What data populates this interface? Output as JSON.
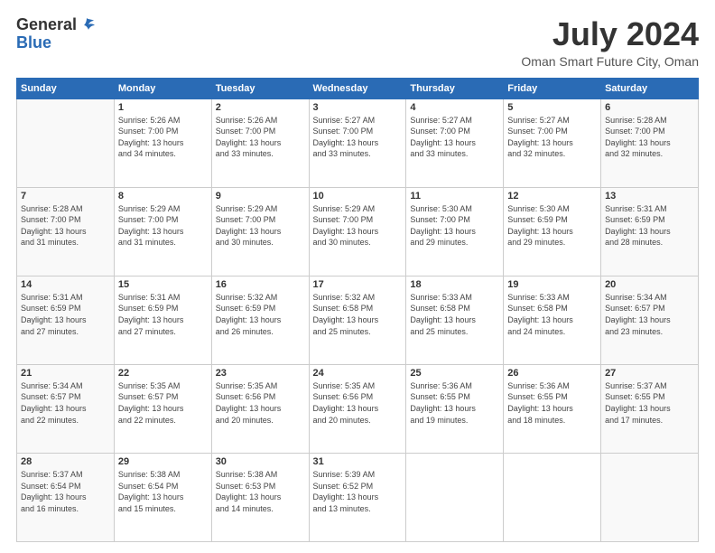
{
  "header": {
    "logo_general": "General",
    "logo_blue": "Blue",
    "month": "July 2024",
    "location": "Oman Smart Future City, Oman"
  },
  "weekdays": [
    "Sunday",
    "Monday",
    "Tuesday",
    "Wednesday",
    "Thursday",
    "Friday",
    "Saturday"
  ],
  "weeks": [
    [
      {
        "day": "",
        "info": ""
      },
      {
        "day": "1",
        "info": "Sunrise: 5:26 AM\nSunset: 7:00 PM\nDaylight: 13 hours\nand 34 minutes."
      },
      {
        "day": "2",
        "info": "Sunrise: 5:26 AM\nSunset: 7:00 PM\nDaylight: 13 hours\nand 33 minutes."
      },
      {
        "day": "3",
        "info": "Sunrise: 5:27 AM\nSunset: 7:00 PM\nDaylight: 13 hours\nand 33 minutes."
      },
      {
        "day": "4",
        "info": "Sunrise: 5:27 AM\nSunset: 7:00 PM\nDaylight: 13 hours\nand 33 minutes."
      },
      {
        "day": "5",
        "info": "Sunrise: 5:27 AM\nSunset: 7:00 PM\nDaylight: 13 hours\nand 32 minutes."
      },
      {
        "day": "6",
        "info": "Sunrise: 5:28 AM\nSunset: 7:00 PM\nDaylight: 13 hours\nand 32 minutes."
      }
    ],
    [
      {
        "day": "7",
        "info": "Sunrise: 5:28 AM\nSunset: 7:00 PM\nDaylight: 13 hours\nand 31 minutes."
      },
      {
        "day": "8",
        "info": "Sunrise: 5:29 AM\nSunset: 7:00 PM\nDaylight: 13 hours\nand 31 minutes."
      },
      {
        "day": "9",
        "info": "Sunrise: 5:29 AM\nSunset: 7:00 PM\nDaylight: 13 hours\nand 30 minutes."
      },
      {
        "day": "10",
        "info": "Sunrise: 5:29 AM\nSunset: 7:00 PM\nDaylight: 13 hours\nand 30 minutes."
      },
      {
        "day": "11",
        "info": "Sunrise: 5:30 AM\nSunset: 7:00 PM\nDaylight: 13 hours\nand 29 minutes."
      },
      {
        "day": "12",
        "info": "Sunrise: 5:30 AM\nSunset: 6:59 PM\nDaylight: 13 hours\nand 29 minutes."
      },
      {
        "day": "13",
        "info": "Sunrise: 5:31 AM\nSunset: 6:59 PM\nDaylight: 13 hours\nand 28 minutes."
      }
    ],
    [
      {
        "day": "14",
        "info": "Sunrise: 5:31 AM\nSunset: 6:59 PM\nDaylight: 13 hours\nand 27 minutes."
      },
      {
        "day": "15",
        "info": "Sunrise: 5:31 AM\nSunset: 6:59 PM\nDaylight: 13 hours\nand 27 minutes."
      },
      {
        "day": "16",
        "info": "Sunrise: 5:32 AM\nSunset: 6:59 PM\nDaylight: 13 hours\nand 26 minutes."
      },
      {
        "day": "17",
        "info": "Sunrise: 5:32 AM\nSunset: 6:58 PM\nDaylight: 13 hours\nand 25 minutes."
      },
      {
        "day": "18",
        "info": "Sunrise: 5:33 AM\nSunset: 6:58 PM\nDaylight: 13 hours\nand 25 minutes."
      },
      {
        "day": "19",
        "info": "Sunrise: 5:33 AM\nSunset: 6:58 PM\nDaylight: 13 hours\nand 24 minutes."
      },
      {
        "day": "20",
        "info": "Sunrise: 5:34 AM\nSunset: 6:57 PM\nDaylight: 13 hours\nand 23 minutes."
      }
    ],
    [
      {
        "day": "21",
        "info": "Sunrise: 5:34 AM\nSunset: 6:57 PM\nDaylight: 13 hours\nand 22 minutes."
      },
      {
        "day": "22",
        "info": "Sunrise: 5:35 AM\nSunset: 6:57 PM\nDaylight: 13 hours\nand 22 minutes."
      },
      {
        "day": "23",
        "info": "Sunrise: 5:35 AM\nSunset: 6:56 PM\nDaylight: 13 hours\nand 20 minutes."
      },
      {
        "day": "24",
        "info": "Sunrise: 5:35 AM\nSunset: 6:56 PM\nDaylight: 13 hours\nand 20 minutes."
      },
      {
        "day": "25",
        "info": "Sunrise: 5:36 AM\nSunset: 6:55 PM\nDaylight: 13 hours\nand 19 minutes."
      },
      {
        "day": "26",
        "info": "Sunrise: 5:36 AM\nSunset: 6:55 PM\nDaylight: 13 hours\nand 18 minutes."
      },
      {
        "day": "27",
        "info": "Sunrise: 5:37 AM\nSunset: 6:55 PM\nDaylight: 13 hours\nand 17 minutes."
      }
    ],
    [
      {
        "day": "28",
        "info": "Sunrise: 5:37 AM\nSunset: 6:54 PM\nDaylight: 13 hours\nand 16 minutes."
      },
      {
        "day": "29",
        "info": "Sunrise: 5:38 AM\nSunset: 6:54 PM\nDaylight: 13 hours\nand 15 minutes."
      },
      {
        "day": "30",
        "info": "Sunrise: 5:38 AM\nSunset: 6:53 PM\nDaylight: 13 hours\nand 14 minutes."
      },
      {
        "day": "31",
        "info": "Sunrise: 5:39 AM\nSunset: 6:52 PM\nDaylight: 13 hours\nand 13 minutes."
      },
      {
        "day": "",
        "info": ""
      },
      {
        "day": "",
        "info": ""
      },
      {
        "day": "",
        "info": ""
      }
    ]
  ]
}
